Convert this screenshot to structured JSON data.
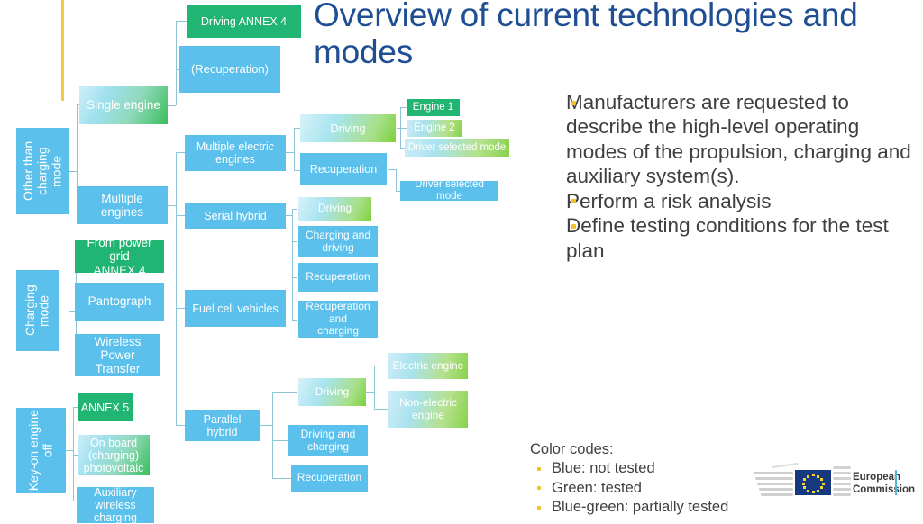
{
  "slide": {
    "title": "Overview of current technologies and modes",
    "accent_color": "#F5C940",
    "title_color": "#1F4E93"
  },
  "bullets": [
    "Manufacturers are requested to describe the high-level operating modes of the propulsion, charging and auxiliary system(s).",
    "Perform a risk analysis",
    "Define testing conditions for the test plan"
  ],
  "color_codes": {
    "title": "Color codes:",
    "items": [
      "Blue: not tested",
      "Green: tested",
      "Blue-green: partially tested"
    ],
    "blue": "#5BC0EB",
    "green": "#21B573",
    "bluegreen": "#8FD9B9"
  },
  "logo": {
    "line1": "European",
    "line2": "Commission"
  },
  "diagram": {
    "level1": [
      {
        "label": "Other than\ncharging mode",
        "style": "blue"
      },
      {
        "label": "Charging mode",
        "style": "blue"
      },
      {
        "label": "Key-on engine\noff",
        "style": "blue"
      }
    ],
    "level2": [
      {
        "label": "Single engine",
        "style": "bluegreen"
      },
      {
        "label": "Multiple engines",
        "style": "blue"
      },
      {
        "label": "From power grid\nANNEX 4",
        "style": "green"
      },
      {
        "label": "Pantograph",
        "style": "blue"
      },
      {
        "label": "Wireless Power\nTransfer",
        "style": "blue"
      },
      {
        "label": "ANNEX 5",
        "style": "green"
      },
      {
        "label": "On board\n(charging)\nphotovoltaic",
        "style": "bluegreen"
      },
      {
        "label": "Auxiliary wireless\ncharging",
        "style": "blue"
      }
    ],
    "level3": [
      {
        "label": "Driving ANNEX 4",
        "style": "green"
      },
      {
        "label": "(Recuperation)",
        "style": "blue"
      },
      {
        "label": "Multiple electric engines",
        "style": "blue"
      },
      {
        "label": "Serial hybrid",
        "style": "blue"
      },
      {
        "label": "Fuel cell vehicles",
        "style": "blue"
      },
      {
        "label": "Parallel hybrid",
        "style": "blue"
      }
    ],
    "level4": [
      {
        "label": "Driving",
        "style": "bluegreen"
      },
      {
        "label": "Recuperation",
        "style": "blue"
      },
      {
        "label": "Driving",
        "style": "bluegreen"
      },
      {
        "label": "Charging and\ndriving",
        "style": "blue"
      },
      {
        "label": "Recuperation",
        "style": "blue"
      },
      {
        "label": "Recuperation and\ncharging",
        "style": "blue"
      },
      {
        "label": "Driving",
        "style": "bluegreen"
      },
      {
        "label": "Driving and\ncharging",
        "style": "blue"
      },
      {
        "label": "Recuperation",
        "style": "blue"
      }
    ],
    "level5": [
      {
        "label": "Engine 1",
        "style": "green"
      },
      {
        "label": "Engine 2",
        "style": "bluegreen"
      },
      {
        "label": "Driver selected mode",
        "style": "bluegreen"
      },
      {
        "label": "Driver selected mode",
        "style": "blue"
      },
      {
        "label": "Electric engine",
        "style": "bluegreen"
      },
      {
        "label": "Non-electric\nengine",
        "style": "bluegreen"
      }
    ]
  }
}
